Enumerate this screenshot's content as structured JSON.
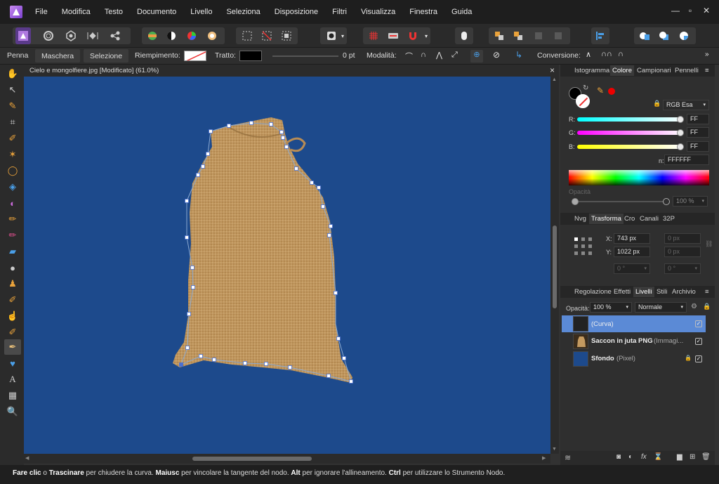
{
  "menu": [
    "File",
    "Modifica",
    "Testo",
    "Documento",
    "Livello",
    "Seleziona",
    "Disposizione",
    "Filtri",
    "Visualizza",
    "Finestra",
    "Guida"
  ],
  "window_controls": {
    "minimize": "—",
    "maximize": "▫",
    "close": "✕"
  },
  "context": {
    "tool": "Penna",
    "mask_btn": "Maschera",
    "selection_btn": "Selezione",
    "fill_label": "Riempimento:",
    "stroke_label": "Tratto:",
    "stroke_width": "0 pt",
    "mode_label": "Modalità:",
    "conversion_label": "Conversione:"
  },
  "document": {
    "tab_title": "Cielo e mongolfiere.jpg [Modificato] (61.0%)",
    "close": "×",
    "canvas_color": "#1d4a8c"
  },
  "color_panel": {
    "tabs": [
      "Istogramma",
      "Colore",
      "Campionari",
      "Pennelli"
    ],
    "active_tab": "Colore",
    "model": "RGB Esa",
    "r": {
      "label": "R:",
      "value": "FF"
    },
    "g": {
      "label": "G:",
      "value": "FF"
    },
    "b": {
      "label": "B:",
      "value": "FF"
    },
    "hex_label": "n:",
    "hex": "FFFFFF",
    "opacity_label": "Opacità",
    "opacity": "100 %"
  },
  "transform_panel": {
    "tabs": [
      "Nvg",
      "Trasforma",
      "Cro",
      "Canali",
      "32P"
    ],
    "active_tab": "Trasforma",
    "x_label": "X:",
    "x": "743 px",
    "y_label": "Y:",
    "y": "1022 px",
    "w": "0 px",
    "h": "0 px",
    "r": "0 °",
    "s": "0 °"
  },
  "layers_panel": {
    "tabs": [
      "Regolazione",
      "Effetti",
      "Livelli",
      "Stili",
      "Archivio"
    ],
    "active_tab": "Livelli",
    "opacity_label": "Opacità:",
    "opacity": "100 %",
    "blend_mode": "Normale",
    "layers": [
      {
        "name": "(Curva)",
        "type": "",
        "selected": true
      },
      {
        "name": "Saccon in juta PNG",
        "type": "(Immagi...",
        "selected": false
      },
      {
        "name": "Sfondo",
        "type": "(Pixel)",
        "selected": false
      }
    ]
  },
  "status": {
    "p1": "Fare clic",
    "p2": " o ",
    "p3": "Trascinare",
    "p4": " per chiudere la curva. ",
    "p5": "Maiusc",
    "p6": " per vincolare la tangente del nodo. ",
    "p7": "Alt",
    "p8": " per ignorare l'allineamento. ",
    "p9": "Ctrl",
    "p10": " per utilizzare lo Strumento Nodo."
  }
}
